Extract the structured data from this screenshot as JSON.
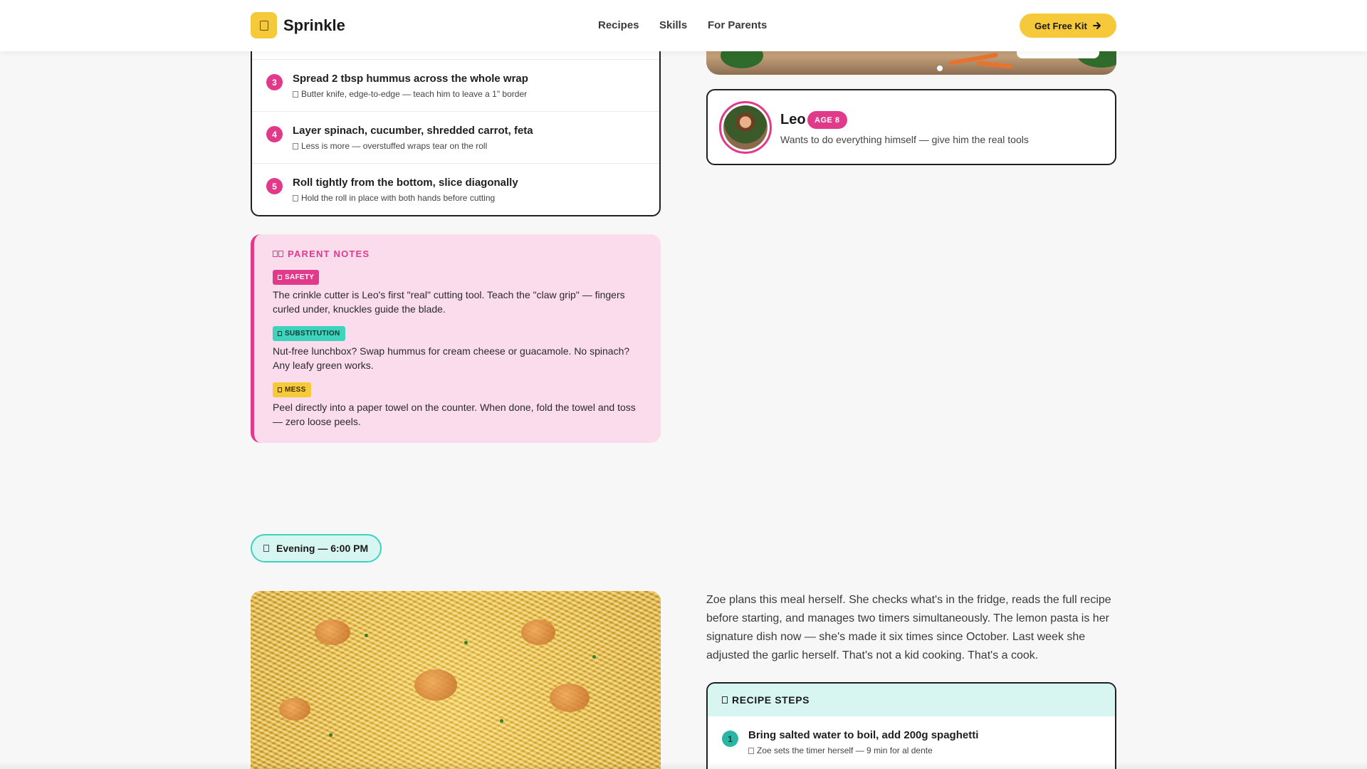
{
  "header": {
    "brand": "Sprinkle",
    "nav": [
      {
        "label": "Recipes"
      },
      {
        "label": "Skills"
      },
      {
        "label": "For Parents"
      }
    ],
    "cta_label": "Get Free Kit",
    "cta_icon": "arrow-right-icon"
  },
  "lunch_steps": [
    {
      "num": "3",
      "title": "Spread 2 tbsp hummus across the whole wrap",
      "tip": "Butter knife, edge-to-edge — teach him to leave a 1\" border"
    },
    {
      "num": "4",
      "title": "Layer spinach, cucumber, shredded carrot, feta",
      "tip": "Less is more — overstuffed wraps tear on the roll"
    },
    {
      "num": "5",
      "title": "Roll tightly from the bottom, slice diagonally",
      "tip": "Hold the roll in place with both hands before cutting"
    }
  ],
  "kid_profile": {
    "name": "Leo",
    "age_badge": "AGE 8",
    "description": "Wants to do everything himself — give him the real tools"
  },
  "parent_notes": {
    "heading": "PARENT NOTES",
    "notes": [
      {
        "tag": "SAFETY",
        "text": "The crinkle cutter is Leo's first \"real\" cutting tool. Teach the \"claw grip\" — fingers curled under, knuckles guide the blade."
      },
      {
        "tag": "SUBSTITUTION",
        "text": "Nut-free lunchbox? Swap hummus for cream cheese or guacamole. No spinach? Any leafy green works."
      },
      {
        "tag": "MESS",
        "text": "Peel directly into a paper towel on the counter. When done, fold the towel and toss — zero loose peels."
      }
    ]
  },
  "evening": {
    "label": "Evening — 6:00 PM",
    "description": "Zoe plans this meal herself. She checks what's in the fridge, reads the full recipe before starting, and manages two timers simultaneously. The lemon pasta is her signature dish now — she's made it six times since October. Last week she adjusted the garlic herself. That's not a kid cooking. That's a cook.",
    "steps_heading": "RECIPE STEPS",
    "steps": [
      {
        "num": "1",
        "title": "Bring salted water to boil, add 200g spaghetti",
        "tip": "Zoe sets the timer herself — 9 min for al dente"
      }
    ]
  },
  "colors": {
    "brand_yellow": "#f6c93b",
    "pink": "#e23a8a",
    "teal": "#3dd3bd",
    "notes_bg": "#fbdced"
  }
}
